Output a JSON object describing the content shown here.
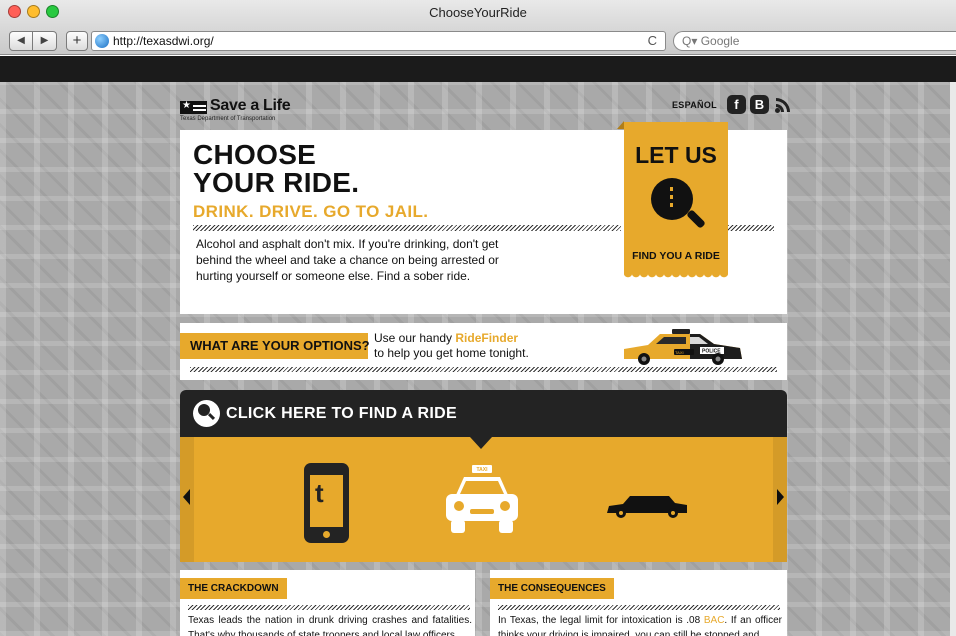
{
  "browser": {
    "window_title": "ChooseYourRide",
    "url": "http://texasdwi.org/",
    "search_placeholder": "Google",
    "nav_back": "◀",
    "nav_forward": "▶",
    "add_tab": "+",
    "reload": "C",
    "search_prefix": "Q▾"
  },
  "colors": {
    "accent": "#e7a92c",
    "dark": "#232323",
    "traffic_close": "#ff5f57",
    "traffic_min": "#ffbd2e",
    "traffic_max": "#28c940"
  },
  "header": {
    "logo_text": "Save a Life",
    "logo_subtext": "Texas Department of Transportation",
    "language_link": "ESPAÑOL",
    "social": [
      {
        "name": "facebook-icon",
        "glyph": "f"
      },
      {
        "name": "blog-icon",
        "glyph": "B"
      },
      {
        "name": "rss-icon",
        "glyph": ""
      }
    ]
  },
  "hero": {
    "headline_line1": "CHOOSE",
    "headline_line2": "YOUR RIDE.",
    "tagline": "DRINK. DRIVE. GO TO JAIL.",
    "body": "Alcohol and asphalt don't mix. If you're drinking, don't get behind the wheel and take a chance on being arrested or hurting yourself or someone else. Find a sober ride."
  },
  "letus": {
    "title": "LET US",
    "footer": "FIND YOU A RIDE"
  },
  "options": {
    "label": "WHAT ARE YOUR OPTIONS?",
    "text_before": "Use our handy ",
    "highlight": "RideFinder",
    "text_after": "to help you get home tonight.",
    "car_badge_taxi": "TAXI",
    "car_badge_police": "POLICE"
  },
  "finder": {
    "title": "CLICK HERE TO FIND A RIDE",
    "phone_glyph": "t",
    "taxi_sign": "TAXI"
  },
  "crackdown": {
    "title": "THE CRACKDOWN",
    "text": "Texas leads the nation in drunk driving crashes and fatalities. That's why thousands of state troopers and local law officers"
  },
  "consequences": {
    "title": "THE CONSEQUENCES",
    "text_before": "In Texas, the legal limit for intoxication is .08 ",
    "highlight": "BAC",
    "text_after": ". If an officer thinks your driving is impaired, you can still be stopped and"
  }
}
